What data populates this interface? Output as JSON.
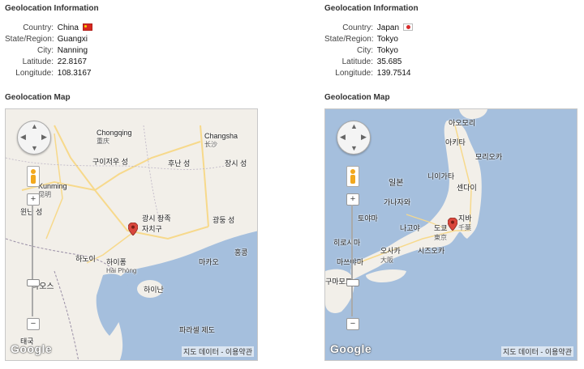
{
  "left": {
    "info_title": "Geolocation Information",
    "country_label": "Country:",
    "country": "China",
    "region_label": "State/Region:",
    "region": "Guangxi",
    "city_label": "City:",
    "city": "Nanning",
    "lat_label": "Latitude:",
    "lat": "22.8167",
    "lon_label": "Longitude:",
    "lon": "108.3167",
    "map_title": "Geolocation Map",
    "map_labels": {
      "chongqing": "Chongqing",
      "chongqing_ko": "重庆",
      "guizhou": "구이저우 성",
      "changsha": "Changsha",
      "changsha_ko": "长沙",
      "hunan": "후난 성",
      "jiangxi": "장시 성",
      "kunming": "Kunming",
      "kunming_ko": "昆明",
      "yunnan": "윈난 성",
      "guangxi1": "광시 좡족",
      "guangxi2": "자치구",
      "guangdong": "광둥 성",
      "hongkong": "홍콩",
      "macau": "마카오",
      "hanoi": "하노이",
      "haiphong": "하이퐁",
      "haiphong_en": "Hải Phòng",
      "laos": "라오스",
      "hainan": "하이난",
      "paracel": "파라셀 제도",
      "thailand": "태국"
    },
    "attribution": "지도 데이터 - 이용약관"
  },
  "right": {
    "info_title": "Geolocation Information",
    "country_label": "Country:",
    "country": "Japan",
    "region_label": "State/Region:",
    "region": "Tokyo",
    "city_label": "City:",
    "city": "Tokyo",
    "lat_label": "Latitude:",
    "lat": "35.685",
    "lon_label": "Longitude:",
    "lon": "139.7514",
    "map_title": "Geolocation Map",
    "map_labels": {
      "aomori": "아오모리",
      "akita": "아키타",
      "morioka": "모리오카",
      "niigata": "니이가타",
      "sendai": "센다이",
      "japan": "일본",
      "kanazawa": "가나자와",
      "toyama": "토야마",
      "chiba": "지바",
      "chiba_ja": "千葉",
      "tokyo": "도쿄",
      "tokyo_ja": "東京",
      "nagoya": "나고야",
      "shizuoka": "시즈오카",
      "hiroshima": "히로시마",
      "osaka": "오사카",
      "osaka_ja": "大阪",
      "matsuyama": "마쓰야마",
      "kumamoto": "구마모토"
    },
    "attribution": "지도 데이터 - 이용약관"
  },
  "google_logo": "Google",
  "colors": {
    "water": "#a5bfdd",
    "land": "#f2efe9",
    "road": "#f7d98b",
    "marker": "#d9463c"
  }
}
